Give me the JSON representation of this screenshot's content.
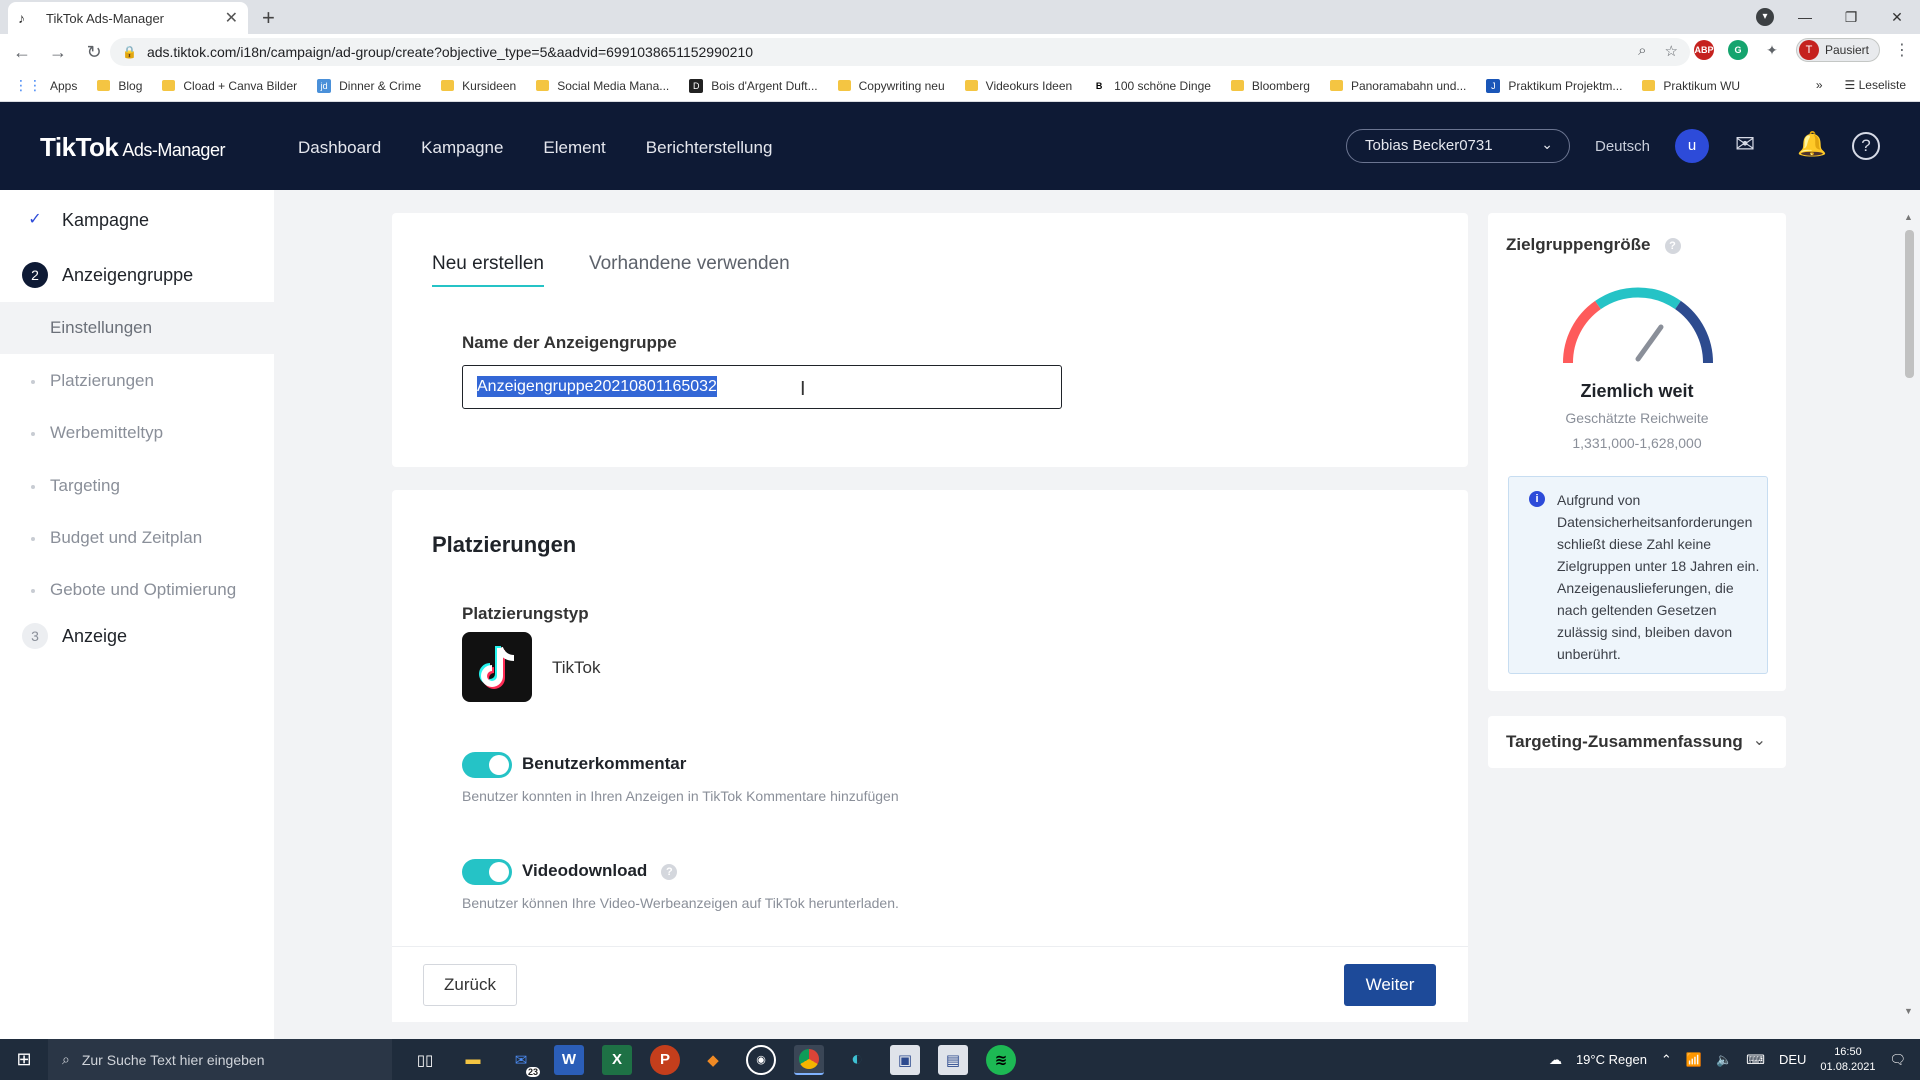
{
  "browser": {
    "tab_title": "TikTok Ads-Manager",
    "url": "ads.tiktok.com/i18n/campaign/ad-group/create?objective_type=5&aadvid=6991038651152990210",
    "profile_status": "Pausiert",
    "profile_initial": "T",
    "bookmarks": [
      {
        "label": "Apps",
        "icon": "apps-grid-icon"
      },
      {
        "label": "Blog",
        "icon": "folder-icon"
      },
      {
        "label": "Cload + Canva Bilder",
        "icon": "folder-icon"
      },
      {
        "label": "Dinner & Crime",
        "icon": "site-icon"
      },
      {
        "label": "Kursideen",
        "icon": "folder-icon"
      },
      {
        "label": "Social Media Mana...",
        "icon": "folder-icon"
      },
      {
        "label": "Bois d'Argent Duft...",
        "icon": "site-icon"
      },
      {
        "label": "Copywriting neu",
        "icon": "folder-icon"
      },
      {
        "label": "Videokurs Ideen",
        "icon": "folder-icon"
      },
      {
        "label": "100 schöne Dinge",
        "icon": "site-icon"
      },
      {
        "label": "Bloomberg",
        "icon": "folder-icon"
      },
      {
        "label": "Panoramabahn und...",
        "icon": "folder-icon"
      },
      {
        "label": "Praktikum Projektm...",
        "icon": "site-icon"
      },
      {
        "label": "Praktikum WU",
        "icon": "folder-icon"
      }
    ],
    "reading_list": "Leseliste"
  },
  "header": {
    "logo_main": "TikTok",
    "logo_sub": "Ads-Manager",
    "nav": [
      "Dashboard",
      "Kampagne",
      "Element",
      "Berichterstellung"
    ],
    "account": "Tobias Becker0731",
    "language": "Deutsch",
    "avatar_initial": "u"
  },
  "sidebar": {
    "steps": [
      {
        "number": "✓",
        "label": "Kampagne"
      },
      {
        "number": "2",
        "label": "Anzeigengruppe"
      },
      {
        "number": "3",
        "label": "Anzeige"
      }
    ],
    "substeps": [
      "Einstellungen",
      "Platzierungen",
      "Werbemitteltyp",
      "Targeting",
      "Budget und Zeitplan",
      "Gebote und Optimierung"
    ]
  },
  "create": {
    "tabs": [
      "Neu erstellen",
      "Vorhandene verwenden"
    ],
    "name_label": "Name der Anzeigengruppe",
    "name_value": "Anzeigengruppe20210801165032"
  },
  "placements": {
    "title": "Platzierungen",
    "type_label": "Platzierungstyp",
    "type_name": "TikTok",
    "comment_label": "Benutzerkommentar",
    "comment_desc": "Benutzer konnten in Ihren Anzeigen in TikTok Kommentare hinzufügen",
    "download_label": "Videodownload",
    "download_desc": "Benutzer können Ihre Video-Werbeanzeigen auf TikTok herunterladen."
  },
  "footer": {
    "back": "Zurück",
    "next": "Weiter"
  },
  "audience": {
    "title": "Zielgruppengröße",
    "level": "Ziemlich weit",
    "reach_label": "Geschätzte Reichweite",
    "reach_range": "1,331,000-1,628,000",
    "info": "Aufgrund von Datensicherheitsanforderungen schließt diese Zahl keine Zielgruppen unter 18 Jahren ein. Anzeigenauslieferungen, die nach geltenden Gesetzen zulässig sind, bleiben davon unberührt.",
    "summary_title": "Targeting-Zusammenfassung"
  },
  "taskbar": {
    "search_placeholder": "Zur Suche Text hier eingeben",
    "weather": "19°C  Regen",
    "lang": "DEU",
    "time": "16:50",
    "date": "01.08.2021",
    "mail_badge": "23"
  },
  "colors": {
    "header_bg": "#0e1a35",
    "accent_teal": "#25c3c6",
    "primary_button": "#1d4a99",
    "selection": "#3367d6"
  }
}
